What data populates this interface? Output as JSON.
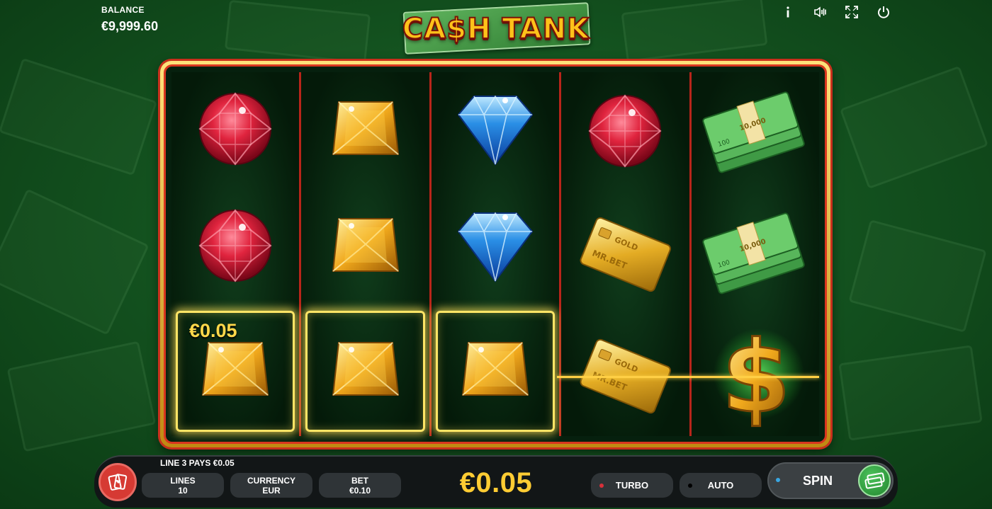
{
  "header": {
    "balance_label": "BALANCE",
    "balance_value": "€9,999.60",
    "logo_text": "CA$H TANK",
    "icons": [
      "info-icon",
      "sound-icon",
      "fullscreen-icon",
      "power-icon"
    ]
  },
  "reels": {
    "columns": [
      [
        "ruby",
        "ruby",
        "gold-gem"
      ],
      [
        "gold-gem",
        "gold-gem",
        "gold-gem"
      ],
      [
        "blue-diamond",
        "blue-diamond",
        "gold-gem"
      ],
      [
        "ruby",
        "gold-card",
        "gold-card"
      ],
      [
        "cash-stack",
        "cash-stack",
        "dollar-sign"
      ]
    ],
    "winning_positions": [
      [
        0,
        2
      ],
      [
        1,
        2
      ],
      [
        2,
        2
      ]
    ],
    "win_amount_label": "€0.05",
    "card_text": "GOLD MR.BET",
    "cash_band_text": "10,000"
  },
  "controls": {
    "line_message": "LINE 3 PAYS €0.05",
    "lines_label": "LINES",
    "lines_value": "10",
    "currency_label": "CURRENCY",
    "currency_value": "EUR",
    "bet_label": "BET",
    "bet_value": "€0.10",
    "total_win": "€0.05",
    "turbo_label": "TURBO",
    "auto_label": "AUTO",
    "spin_label": "SPIN"
  },
  "colors": {
    "gold": "#ffcc33",
    "frame_red": "#d9361f",
    "turbo_dot": "#d7303a",
    "auto_dot": "#555b5e",
    "spin_dot": "#39a7e3"
  }
}
